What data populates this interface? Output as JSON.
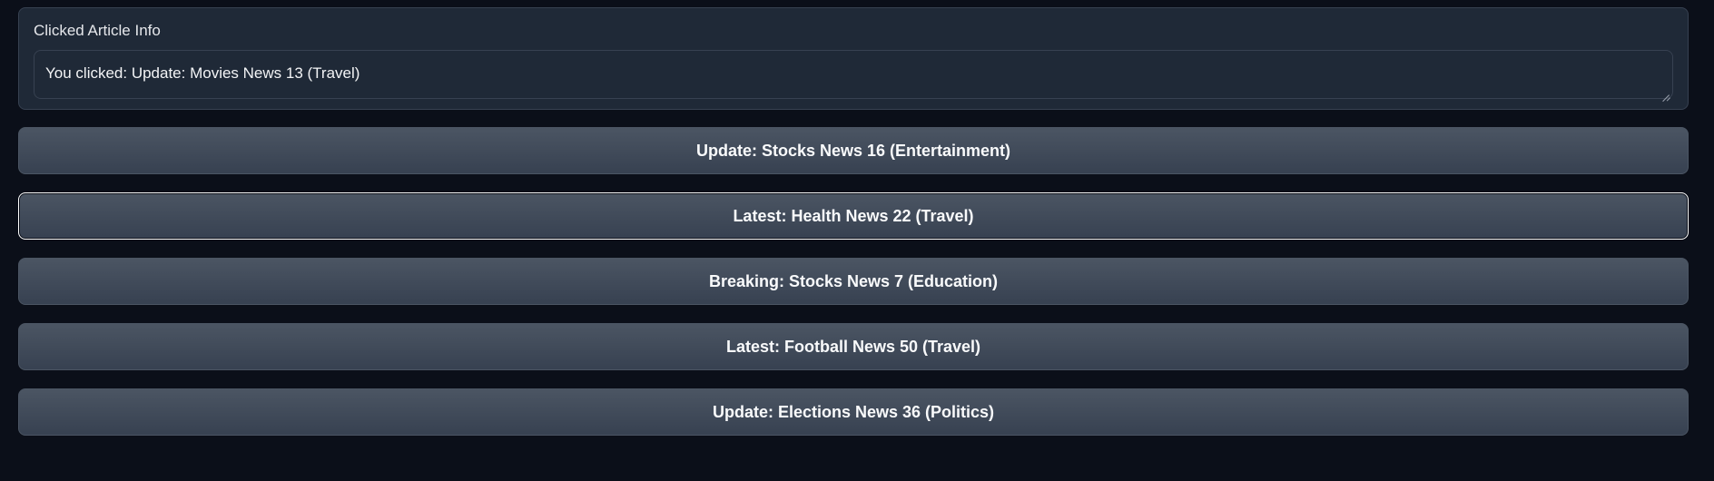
{
  "clicked_info": {
    "label": "Clicked Article Info",
    "value": "You clicked: Update: Movies News 13 (Travel)"
  },
  "articles": [
    {
      "label": "Update: Stocks News 16 (Entertainment)"
    },
    {
      "label": "Latest: Health News 22 (Travel)"
    },
    {
      "label": "Breaking: Stocks News 7 (Education)"
    },
    {
      "label": "Latest: Football News 50 (Travel)"
    },
    {
      "label": "Update: Elections News 36 (Politics)"
    }
  ]
}
